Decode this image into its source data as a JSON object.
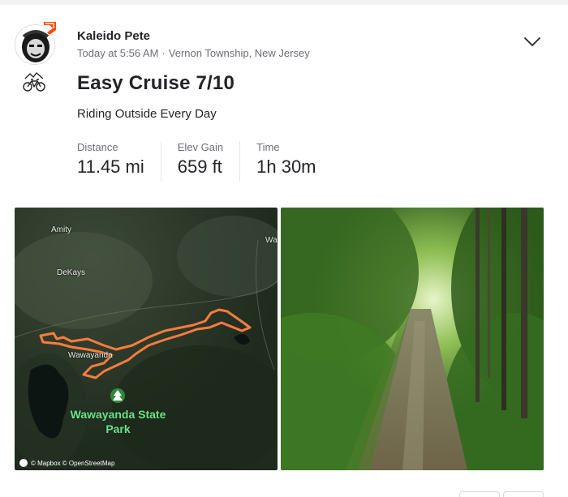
{
  "athlete": {
    "name": "Kaleido Pete",
    "timestamp": "Today at 5:56 AM",
    "location": "Vernon Township, New Jersey"
  },
  "activity": {
    "sport_icon": "mountain-bike-icon",
    "title": "Easy Cruise 7/10",
    "description": "Riding Outside Every Day"
  },
  "stats": [
    {
      "label": "Distance",
      "value": "11.45 mi"
    },
    {
      "label": "Elev Gain",
      "value": "659 ft"
    },
    {
      "label": "Time",
      "value": "1h 30m"
    }
  ],
  "map": {
    "labels": [
      "Amity",
      "DeKays",
      "Wawayanda",
      "Wa"
    ],
    "park_label": "Wawayanda State Park",
    "attribution": "© Mapbox © OpenStreetMap",
    "route_color": "#fc7b3e"
  },
  "colors": {
    "accent": "#fc4c02",
    "text": "#242428",
    "muted": "#6d6d78"
  }
}
